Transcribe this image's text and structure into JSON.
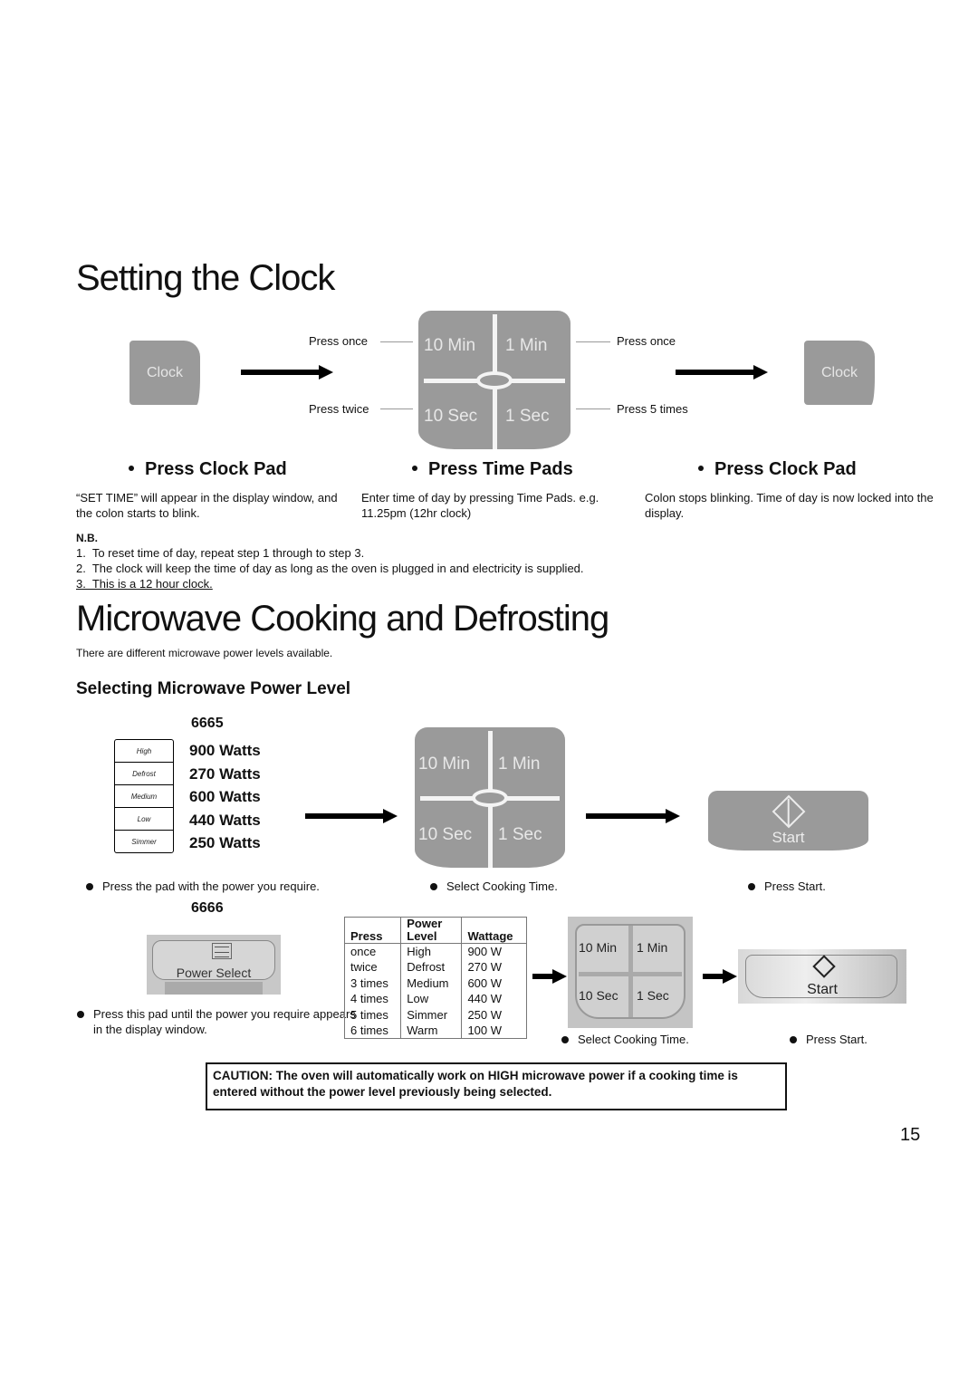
{
  "section1": {
    "title": "Setting the Clock",
    "clock_pad_label": "Clock",
    "time_pads": [
      "10 Min",
      "1 Min",
      "10 Sec",
      "1 Sec"
    ],
    "left_callouts": {
      "top": "Press once",
      "bottom": "Press twice"
    },
    "right_callouts": {
      "top": "Press once",
      "bottom": "Press 5 times"
    },
    "steps": [
      {
        "title": "Press Clock Pad",
        "desc": "“SET TIME” will appear in the display window, and the colon starts to blink."
      },
      {
        "title": "Press Time Pads",
        "desc": "Enter time of day by pressing Time Pads. e.g. 11.25pm (12hr clock)"
      },
      {
        "title": "Press Clock Pad",
        "desc": "Colon stops blinking. Time of day is now locked into the display."
      }
    ],
    "nb": {
      "label": "N.B.",
      "items": [
        "1.  To reset time of day, repeat step 1 through to step 3.",
        "2.  The clock will keep the time of day as long as the oven is plugged in and electricity is supplied.",
        "3.  This is a 12 hour clock."
      ]
    }
  },
  "section2": {
    "title": "Microwave Cooking and Defrosting",
    "intro": "There are different microwave power levels available.",
    "subtitle": "Selecting Microwave Power Level",
    "model_a": {
      "model": "6665",
      "level_buttons": [
        "High",
        "Defrost",
        "Medium",
        "Low",
        "Simmer"
      ],
      "watts": [
        "900 Watts",
        "270 Watts",
        "600 Watts",
        "440 Watts",
        "250 Watts"
      ],
      "time_pads": [
        "10 Min",
        "1 Min",
        "10 Sec",
        "1 Sec"
      ],
      "start_label": "Start",
      "captions": [
        "Press the pad with the power you require.",
        "Select Cooking Time.",
        "Press Start."
      ]
    },
    "model_b": {
      "model": "6666",
      "power_select_label": "Power Select",
      "caption": "Press this pad until the power you require appears in the display window.",
      "table": {
        "headers": [
          "Press",
          "Power Level",
          "Wattage"
        ],
        "header_lines": [
          [
            "Press"
          ],
          [
            "Power",
            "Level"
          ],
          [
            "Wattage"
          ]
        ],
        "rows": [
          [
            "once",
            "High",
            "900 W"
          ],
          [
            "twice",
            "Defrost",
            "270 W"
          ],
          [
            "3 times",
            "Medium",
            "600 W"
          ],
          [
            "4 times",
            "Low",
            "440 W"
          ],
          [
            "5 times",
            "Simmer",
            "250 W"
          ],
          [
            "6 times",
            "Warm",
            "100 W"
          ]
        ]
      },
      "time_pads": [
        "10 Min",
        "1 Min",
        "10 Sec",
        "1 Sec"
      ],
      "start_label": "Start",
      "captions": [
        "Select Cooking Time.",
        "Press Start."
      ]
    },
    "caution": "CAUTION: The oven will automatically work on HIGH microwave power if a cooking time is entered without the power level previously being selected."
  },
  "page_number": "15"
}
